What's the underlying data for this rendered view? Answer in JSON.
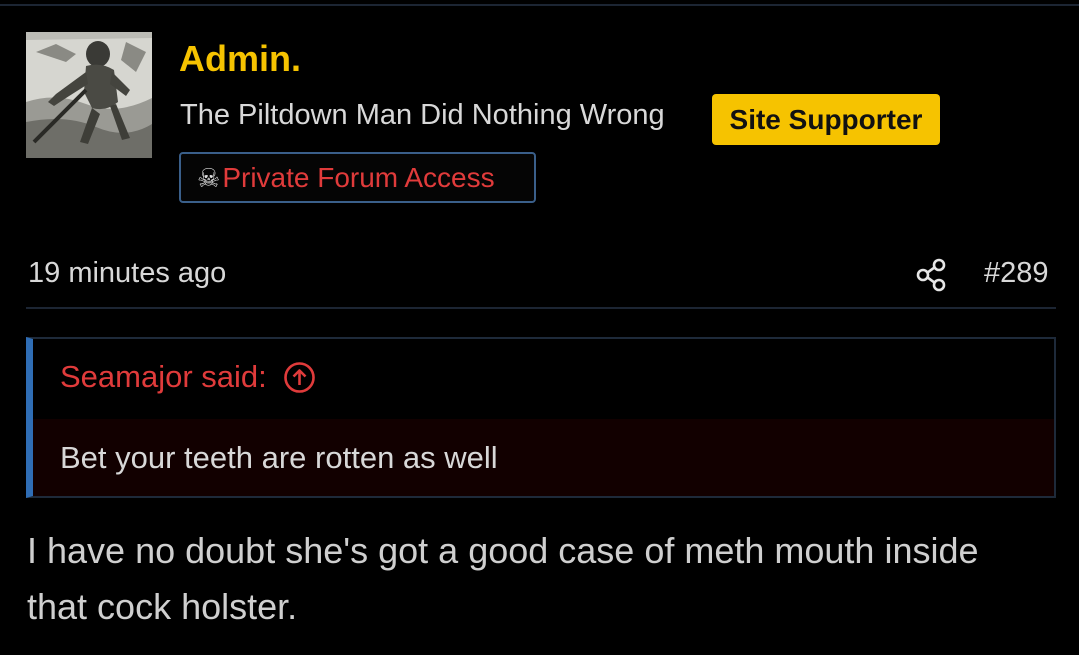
{
  "user": {
    "name": "Admin.",
    "title": "The Piltdown Man Did Nothing Wrong",
    "avatar_description": "avatar-engraving",
    "badges": {
      "supporter": "Site Supporter",
      "private_icon": "skull-and-crossbones-icon",
      "private_glyph": "☠",
      "private": "Private Forum Access"
    }
  },
  "post": {
    "time": "19 minutes ago",
    "number": "#289",
    "share_icon": "share-icon",
    "quote": {
      "author": "Seamajor said:",
      "jump_icon": "arrow-up-circle-icon",
      "text": "Bet your teeth are rotten as well"
    },
    "body": "I have no doubt she's got a good case of meth mouth inside that cock holster."
  },
  "colors": {
    "background": "#000000",
    "username": "#f6c300",
    "supporter_badge_bg": "#f6c300",
    "quote_author": "#e03b3b",
    "quote_bar": "#2f6db5",
    "private_badge_border": "#3a5f8a",
    "text": "#d8d8d8"
  }
}
